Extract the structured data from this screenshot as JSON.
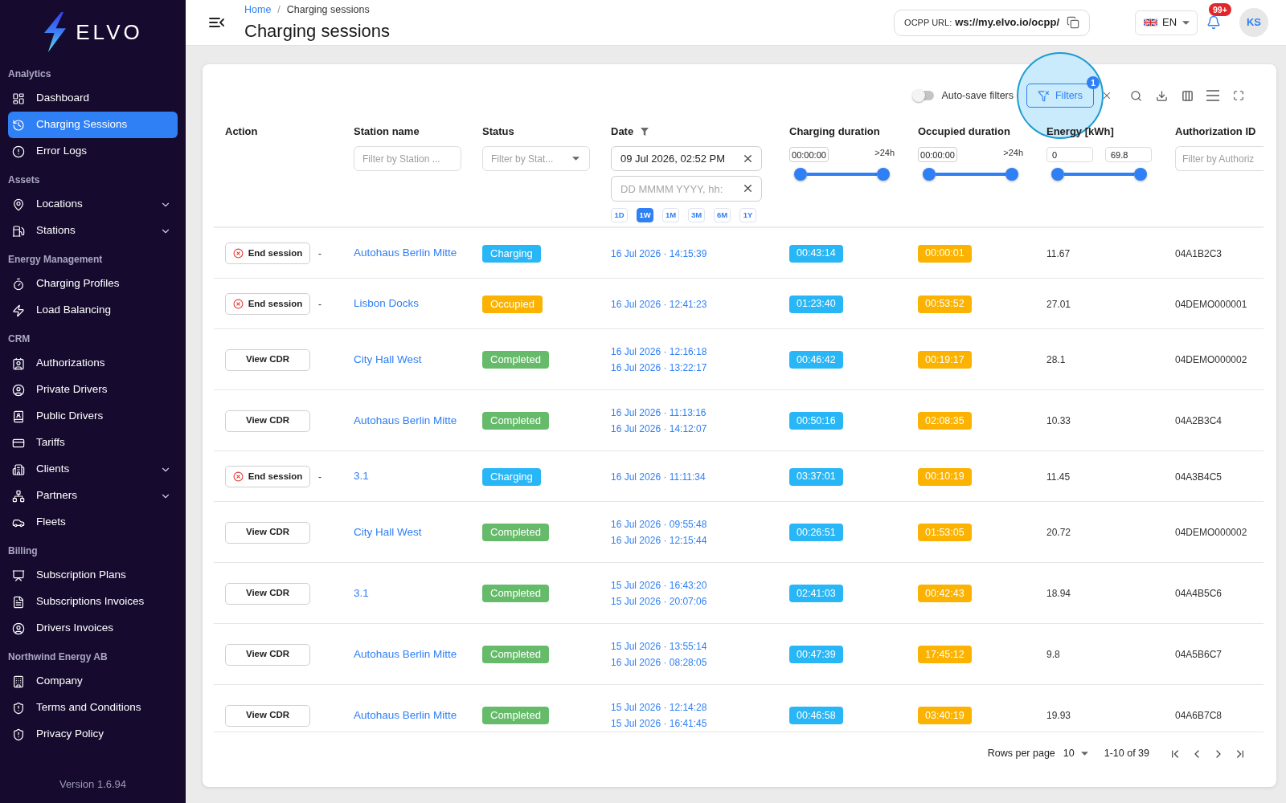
{
  "sidebar": {
    "logo": {
      "text": "ELVO"
    },
    "sections": [
      {
        "title": "Analytics",
        "items": [
          {
            "label": "Dashboard",
            "kind": "link",
            "selected": false
          },
          {
            "label": "Charging Sessions",
            "kind": "link",
            "selected": true
          },
          {
            "label": "Error Logs",
            "kind": "link",
            "selected": false
          }
        ]
      },
      {
        "title": "Assets",
        "items": [
          {
            "label": "Locations",
            "kind": "group",
            "selected": false
          },
          {
            "label": "Stations",
            "kind": "group",
            "selected": false
          }
        ]
      },
      {
        "title": "Energy Management",
        "items": [
          {
            "label": "Charging Profiles",
            "kind": "link",
            "selected": false
          },
          {
            "label": "Load Balancing",
            "kind": "link",
            "selected": false
          }
        ]
      },
      {
        "title": "CRM",
        "items": [
          {
            "label": "Authorizations",
            "kind": "link",
            "selected": false
          },
          {
            "label": "Private Drivers",
            "kind": "link",
            "selected": false
          },
          {
            "label": "Public Drivers",
            "kind": "link",
            "selected": false
          },
          {
            "label": "Tariffs",
            "kind": "link",
            "selected": false
          },
          {
            "label": "Clients",
            "kind": "group",
            "selected": false
          },
          {
            "label": "Partners",
            "kind": "group",
            "selected": false
          },
          {
            "label": "Fleets",
            "kind": "link",
            "selected": false
          }
        ]
      },
      {
        "title": "Billing",
        "items": [
          {
            "label": "Subscription Plans",
            "kind": "link",
            "selected": false
          },
          {
            "label": "Subscriptions Invoices",
            "kind": "link",
            "selected": false
          },
          {
            "label": "Drivers Invoices",
            "kind": "link",
            "selected": false
          }
        ]
      },
      {
        "title": "Northwind Energy AB",
        "items": [
          {
            "label": "Company",
            "kind": "link",
            "selected": false
          },
          {
            "label": "Terms and Conditions",
            "kind": "link",
            "selected": false
          },
          {
            "label": "Privacy Policy",
            "kind": "link",
            "selected": false
          }
        ]
      }
    ],
    "version": "Version 1.6.94"
  },
  "header": {
    "breadcrumb": {
      "items": [
        {
          "label": "Home",
          "kind": "link"
        },
        {
          "label": "Charging sessions",
          "kind": "current"
        }
      ],
      "separator": "/"
    },
    "title": "Charging sessions",
    "ocpp_url": {
      "label": "OCPP URL:",
      "value": "ws://my.elvo.io/ocpp/"
    },
    "language": "EN",
    "notifications": {
      "badge": "99+"
    },
    "avatar": "KS"
  },
  "toolbar": {
    "auto_save": {
      "label": "Auto-save filters",
      "on": false
    },
    "filters": {
      "label": "Filters",
      "badge": "1",
      "highlighted": true
    }
  },
  "table": {
    "columns": [
      {
        "label": "Action",
        "filtered": false
      },
      {
        "label": "Station name",
        "filtered": false,
        "filter": {
          "kind": "text",
          "placeholder": "Filter by Station ..."
        }
      },
      {
        "label": "Status",
        "filtered": false,
        "filter": {
          "kind": "select",
          "placeholder": "Filter by Stat..."
        }
      },
      {
        "label": "Date",
        "filtered": true,
        "filter": {
          "kind": "date_range",
          "from": {
            "value": "09 Jul 2026, 02:52 PM"
          },
          "to": {
            "placeholder": "DD MMMM YYYY, hh:"
          },
          "presets": [
            {
              "label": "1D",
              "selected": false
            },
            {
              "label": "1W",
              "selected": true
            },
            {
              "label": "1M",
              "selected": false
            },
            {
              "label": "3M",
              "selected": false
            },
            {
              "label": "6M",
              "selected": false
            },
            {
              "label": "1Y",
              "selected": false
            }
          ]
        }
      },
      {
        "label": "Charging duration",
        "filtered": false,
        "filter": {
          "kind": "duration_range",
          "min": "00:00:00",
          "max": ">24h",
          "level": 1
        }
      },
      {
        "label": "Occupied duration",
        "filtered": false,
        "filter": {
          "kind": "duration_range",
          "min": "00:00:00",
          "max": ">24h",
          "level": 1
        }
      },
      {
        "label": "Energy [kWh]",
        "filtered": false,
        "filter": {
          "kind": "number_range",
          "min": "0",
          "max": "69.8",
          "level": 1
        }
      },
      {
        "label": "Authorization ID",
        "filtered": false,
        "filter": {
          "kind": "text",
          "placeholder": "Filter by Authoriz"
        }
      }
    ],
    "rows": [
      {
        "action": {
          "kind": "end_session",
          "label": "End session",
          "note": "-"
        },
        "station": "Autohaus Berlin Mitte",
        "status": {
          "label": "Charging",
          "color": "#29b6f6"
        },
        "dates": [
          "16 Jul 2026 · 14:15:39"
        ],
        "charging_duration": "00:43:14",
        "occupied_duration": "00:00:01",
        "energy": "11.67",
        "authorization_id": "04A1B2C3"
      },
      {
        "action": {
          "kind": "end_session",
          "label": "End session",
          "note": "-"
        },
        "station": "Lisbon Docks",
        "status": {
          "label": "Occupied",
          "color": "#fbb200"
        },
        "dates": [
          "16 Jul 2026 · 12:41:23"
        ],
        "charging_duration": "01:23:40",
        "occupied_duration": "00:53:52",
        "energy": "27.01",
        "authorization_id": "04DEMO000001"
      },
      {
        "action": {
          "kind": "view_cdr",
          "label": "View CDR"
        },
        "station": "City Hall West",
        "status": {
          "label": "Completed",
          "color": "#66bb6a"
        },
        "dates": [
          "16 Jul 2026 · 12:16:18",
          "16 Jul 2026 · 13:22:17"
        ],
        "charging_duration": "00:46:42",
        "occupied_duration": "00:19:17",
        "energy": "28.1",
        "authorization_id": "04DEMO000002"
      },
      {
        "action": {
          "kind": "view_cdr",
          "label": "View CDR"
        },
        "station": "Autohaus Berlin Mitte",
        "status": {
          "label": "Completed",
          "color": "#66bb6a"
        },
        "dates": [
          "16 Jul 2026 · 11:13:16",
          "16 Jul 2026 · 14:12:07"
        ],
        "charging_duration": "00:50:16",
        "occupied_duration": "02:08:35",
        "energy": "10.33",
        "authorization_id": "04A2B3C4"
      },
      {
        "action": {
          "kind": "end_session",
          "label": "End session",
          "note": "-"
        },
        "station": "3.1",
        "status": {
          "label": "Charging",
          "color": "#29b6f6"
        },
        "dates": [
          "16 Jul 2026 · 11:11:34"
        ],
        "charging_duration": "03:37:01",
        "occupied_duration": "00:10:19",
        "energy": "11.45",
        "authorization_id": "04A3B4C5"
      },
      {
        "action": {
          "kind": "view_cdr",
          "label": "View CDR"
        },
        "station": "City Hall West",
        "status": {
          "label": "Completed",
          "color": "#66bb6a"
        },
        "dates": [
          "16 Jul 2026 · 09:55:48",
          "16 Jul 2026 · 12:15:44"
        ],
        "charging_duration": "00:26:51",
        "occupied_duration": "01:53:05",
        "energy": "20.72",
        "authorization_id": "04DEMO000002"
      },
      {
        "action": {
          "kind": "view_cdr",
          "label": "View CDR"
        },
        "station": "3.1",
        "status": {
          "label": "Completed",
          "color": "#66bb6a"
        },
        "dates": [
          "15 Jul 2026 · 16:43:20",
          "15 Jul 2026 · 20:07:06"
        ],
        "charging_duration": "02:41:03",
        "occupied_duration": "00:42:43",
        "energy": "18.94",
        "authorization_id": "04A4B5C6"
      },
      {
        "action": {
          "kind": "view_cdr",
          "label": "View CDR"
        },
        "station": "Autohaus Berlin Mitte",
        "status": {
          "label": "Completed",
          "color": "#66bb6a"
        },
        "dates": [
          "15 Jul 2026 · 13:55:14",
          "16 Jul 2026 · 08:28:05"
        ],
        "charging_duration": "00:47:39",
        "occupied_duration": "17:45:12",
        "energy": "9.8",
        "authorization_id": "04A5B6C7"
      },
      {
        "action": {
          "kind": "view_cdr",
          "label": "View CDR"
        },
        "station": "Autohaus Berlin Mitte",
        "status": {
          "label": "Completed",
          "color": "#66bb6a"
        },
        "dates": [
          "15 Jul 2026 · 12:14:28",
          "15 Jul 2026 · 16:41:45"
        ],
        "charging_duration": "00:46:58",
        "occupied_duration": "03:40:19",
        "energy": "19.93",
        "authorization_id": "04A6B7C8"
      }
    ]
  },
  "pagination": {
    "rows_per_page_label": "Rows per page",
    "rows_per_page": "10",
    "range": "1-10 of 39"
  }
}
